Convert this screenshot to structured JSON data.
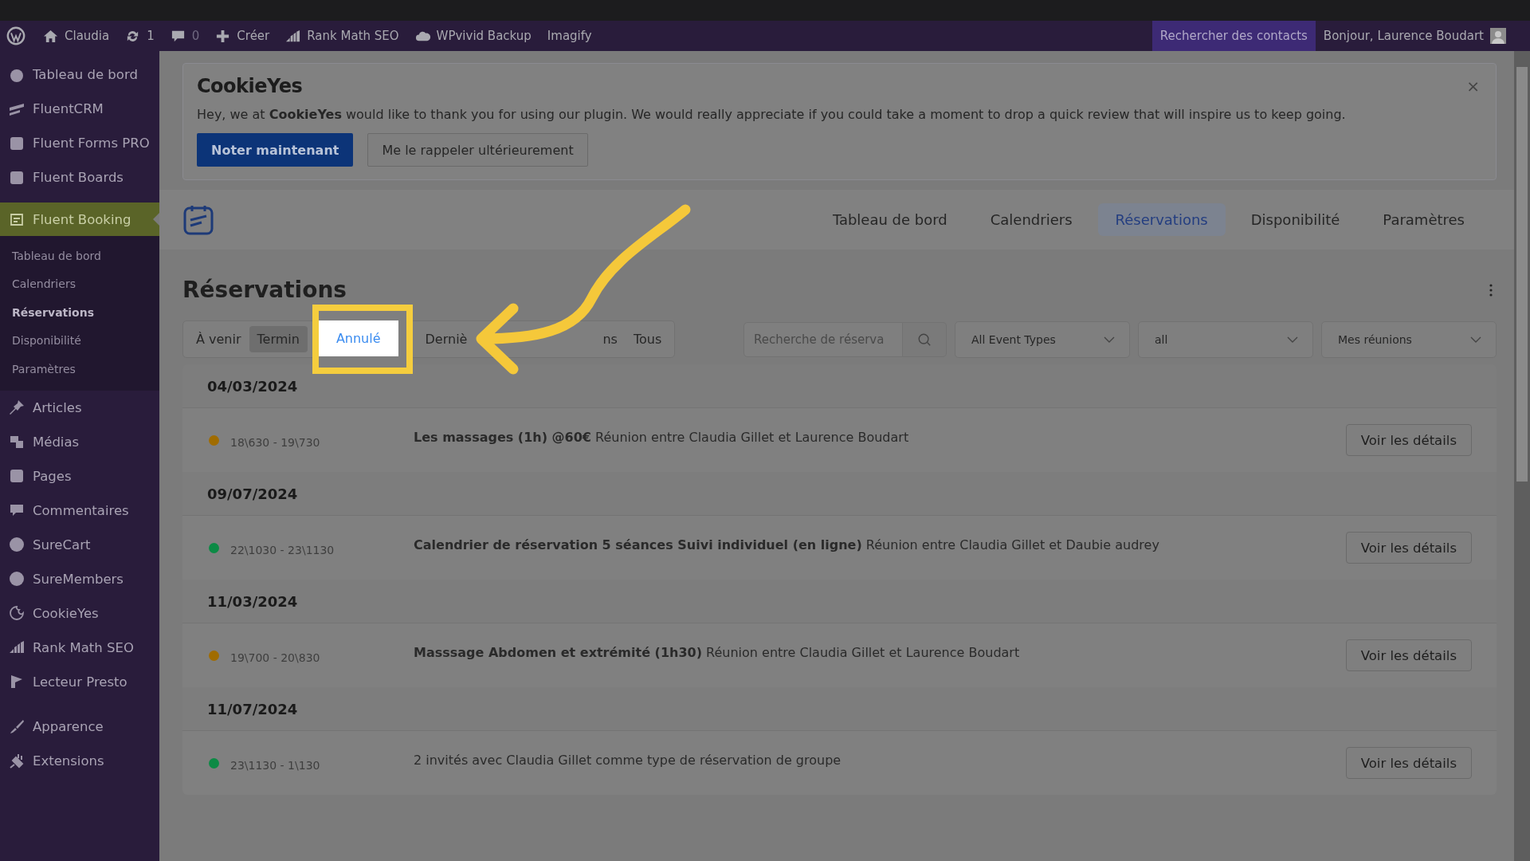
{
  "admin_bar": {
    "items": [
      {
        "label": "Claudia"
      },
      {
        "label": "1"
      },
      {
        "label": "0"
      },
      {
        "label": "Créer"
      },
      {
        "label": "Rank Math SEO"
      },
      {
        "label": "WPvivid Backup"
      },
      {
        "label": "Imagify"
      }
    ],
    "search_contacts": "Rechercher des contacts",
    "greeting": "Bonjour, Laurence Boudart"
  },
  "sidebar": {
    "items": [
      {
        "label": "Tableau de bord",
        "selected": false
      },
      {
        "label": "FluentCRM",
        "selected": false
      },
      {
        "label": "Fluent Forms PRO",
        "selected": false
      },
      {
        "label": "Fluent Boards",
        "selected": false
      },
      {
        "label": "Fluent Booking",
        "selected": true,
        "children": [
          {
            "label": "Tableau de bord",
            "selected": false
          },
          {
            "label": "Calendriers",
            "selected": false
          },
          {
            "label": "Réservations",
            "selected": true
          },
          {
            "label": "Disponibilité",
            "selected": false
          },
          {
            "label": "Paramètres",
            "selected": false
          }
        ]
      },
      {
        "label": "Articles",
        "selected": false
      },
      {
        "label": "Médias",
        "selected": false
      },
      {
        "label": "Pages",
        "selected": false
      },
      {
        "label": "Commentaires",
        "selected": false
      },
      {
        "label": "SureCart",
        "selected": false
      },
      {
        "label": "SureMembers",
        "selected": false
      },
      {
        "label": "CookieYes",
        "selected": false
      },
      {
        "label": "Rank Math SEO",
        "selected": false
      },
      {
        "label": "Lecteur Presto",
        "selected": false
      },
      {
        "label": "Apparence",
        "selected": false
      },
      {
        "label": "Extensions",
        "selected": false
      }
    ]
  },
  "notice": {
    "logo": "CookieYes",
    "text": "Hey, we at **CookieYes** would like to thank you for using our plugin. We would really appreciate if you could take a moment to drop a quick review that will inspire us to keep going.",
    "primary_button": "Noter maintenant",
    "secondary_button": "Me le rappeler ultérieurement",
    "close": "×"
  },
  "nav": {
    "tabs": [
      {
        "label": "Tableau de bord",
        "selected": false
      },
      {
        "label": "Calendriers",
        "selected": false
      },
      {
        "label": "Réservations",
        "selected": true
      },
      {
        "label": "Disponibilité",
        "selected": false
      },
      {
        "label": "Paramètres",
        "selected": false
      }
    ]
  },
  "page": {
    "title": "Réservations",
    "filter_tabs": [
      {
        "label": "À venir",
        "selected": false,
        "hovered": false
      },
      {
        "label": "Termin",
        "selected": false,
        "hovered": true
      },
      {
        "label": "Annulé",
        "selected": true,
        "hovered": false
      },
      {
        "label": "Derniè",
        "selected": false,
        "hovered": false
      },
      {
        "label": "ns",
        "selected": false,
        "hovered": false
      },
      {
        "label": "Tous",
        "selected": false,
        "hovered": false
      }
    ],
    "search": {
      "placeholder": "Recherche de réserva"
    },
    "dropdowns": [
      "All Event Types",
      "all",
      "Mes réunions"
    ],
    "groups": [
      {
        "date": "04/03/2024",
        "bookings": [
          {
            "time": "18\\630 - 19\\730",
            "title": "**Les massages (1h) @60€** Réunion entre Claudia Gillet et Laurence Boudart",
            "color": "#a06c00",
            "button": "Voir les détails"
          }
        ]
      },
      {
        "date": "09/07/2024",
        "bookings": [
          {
            "time": "22\\1030 - 23\\1130",
            "title": "**Calendrier de réservation 5 séances Suivi individuel (en ligne)** Réunion entre Claudia Gillet et Daubie audrey",
            "color": "#0c8a45",
            "button": "Voir les détails"
          }
        ]
      },
      {
        "date": "11/03/2024",
        "bookings": [
          {
            "time": "19\\700 - 20\\830",
            "title": "**Masssage Abdomen et extrémité (1h30)** Réunion entre Claudia Gillet et Laurence Boudart",
            "color": "#a06c00",
            "button": "Voir les détails"
          }
        ]
      },
      {
        "date": "11/07/2024",
        "bookings": [
          {
            "time": "23\\1130 - 1\\130",
            "title": "2 invités avec Claudia Gillet comme type de réservation de groupe",
            "color": "#0c8a45",
            "button": "Voir les détails"
          }
        ]
      }
    ]
  }
}
